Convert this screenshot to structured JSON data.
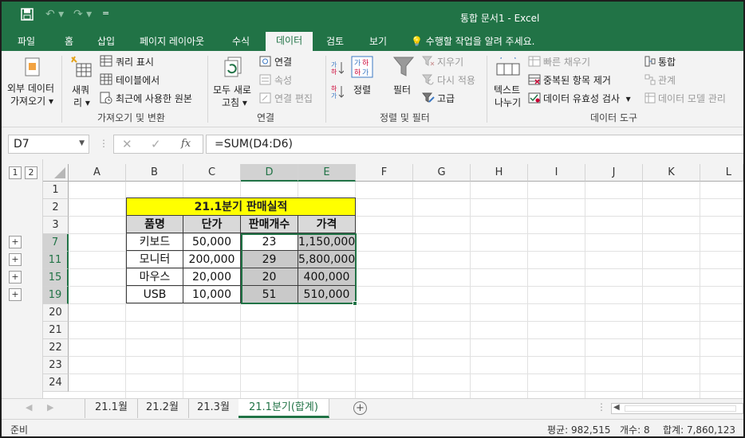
{
  "titlebar": {
    "title": "통합 문서1 - Excel",
    "dropdown": "="
  },
  "tabs": [
    "파일",
    "홈",
    "삽입",
    "페이지 레이아웃",
    "수식",
    "데이터",
    "검토",
    "보기"
  ],
  "tell_me": "수행할 작업을 알려 주세요.",
  "ribbon": {
    "get_external_1": "외부 데이터",
    "get_external_2": "가져오기",
    "new_query_1": "새쿼",
    "new_query_2": "리",
    "show_queries": "쿼리 표시",
    "from_table": "테이블에서",
    "recent_sources": "최근에 사용한 원본",
    "group_get": "가져오기 및 변환",
    "refresh_all_1": "모두 새로",
    "refresh_all_2": "고침",
    "connections": "연결",
    "properties": "속성",
    "edit_links": "연결 편집",
    "group_connections": "연결",
    "sort": "정렬",
    "filter": "필터",
    "clear": "지우기",
    "reapply": "다시 적용",
    "advanced": "고급",
    "group_sort": "정렬 및 필터",
    "text_to_cols_1": "텍스트",
    "text_to_cols_2": "나누기",
    "flash_fill": "빠른 채우기",
    "remove_dupes": "중복된 항목 제거",
    "data_validation": "데이터 유효성 검사",
    "consolidate": "통합",
    "relationships": "관계",
    "manage_model": "데이터 모델 관리",
    "group_tools": "데이터 도구"
  },
  "formula_bar": {
    "name_box": "D7",
    "formula": "=SUM(D4:D6)",
    "fx": "fx"
  },
  "outline_levels": [
    "1",
    "2"
  ],
  "columns": [
    "A",
    "B",
    "C",
    "D",
    "E",
    "F",
    "G",
    "H",
    "I",
    "J",
    "K",
    "L"
  ],
  "rows": [
    "1",
    "2",
    "3",
    "7",
    "11",
    "15",
    "19",
    "20",
    "21",
    "22",
    "23",
    "24"
  ],
  "table": {
    "title": "21.1분기 판매실적",
    "headers": [
      "품명",
      "단가",
      "판매개수",
      "가격"
    ],
    "data": [
      [
        "키보드",
        "50,000",
        "23",
        "1,150,000"
      ],
      [
        "모니터",
        "200,000",
        "29",
        "5,800,000"
      ],
      [
        "마우스",
        "20,000",
        "20",
        "400,000"
      ],
      [
        "USB",
        "10,000",
        "51",
        "510,000"
      ]
    ]
  },
  "sheets": [
    "21.1월",
    "21.2월",
    "21.3월",
    "21.1분기(합계)"
  ],
  "status": {
    "ready": "준비",
    "average": "평균: 982,515",
    "count": "개수: 8",
    "sum": "합계: 7,860,123"
  },
  "colors": {
    "accent": "#217346",
    "title_fill": "#ffff00",
    "cell_gray": "#c9c9c9"
  }
}
